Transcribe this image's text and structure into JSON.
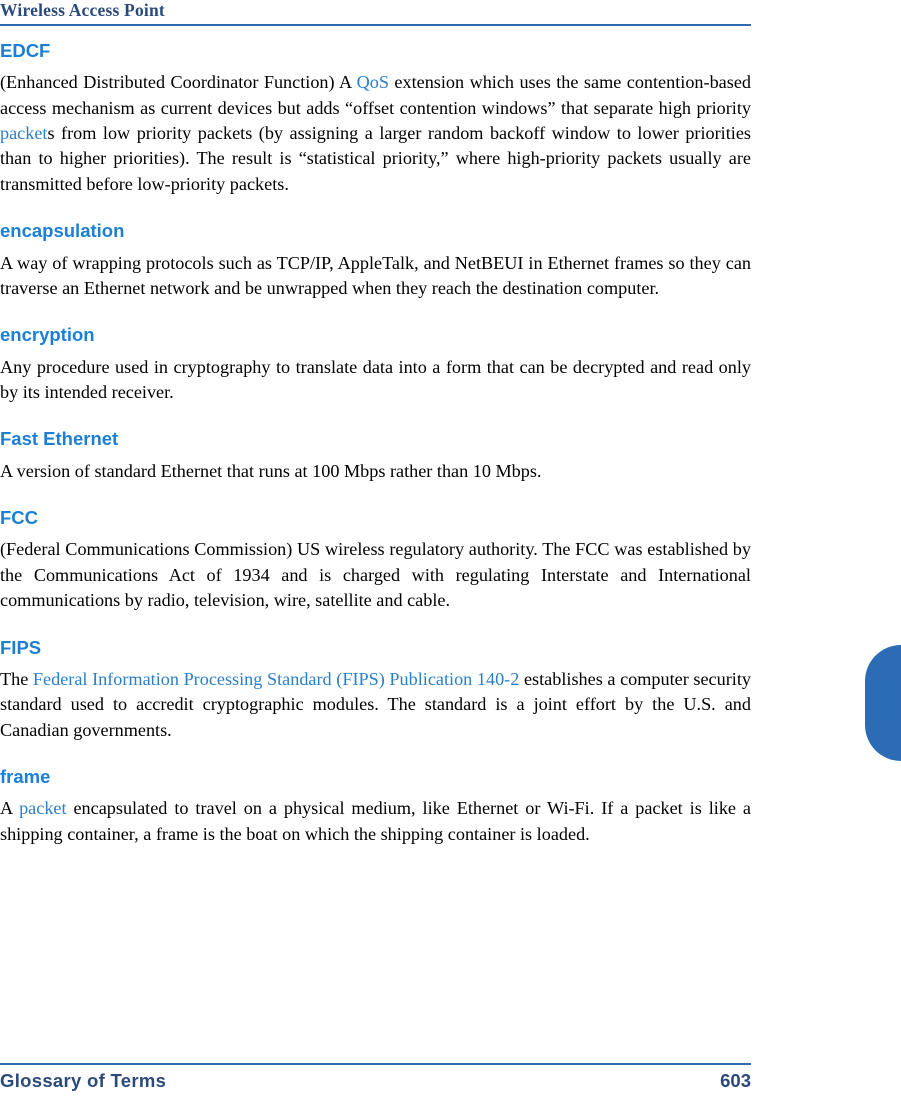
{
  "header": {
    "title": "Wireless Access Point"
  },
  "footer": {
    "section": "Glossary of Terms",
    "page_number": "603"
  },
  "entries": [
    {
      "term": "EDCF",
      "parts": [
        {
          "text": "(Enhanced Distributed Coordinator Function) A ",
          "link": false
        },
        {
          "text": "QoS",
          "link": true
        },
        {
          "text": " extension which uses the same contention-based access mechanism as current devices but adds “offset contention windows” that separate high priority ",
          "link": false
        },
        {
          "text": "packet",
          "link": true
        },
        {
          "text": "s from low priority packets (by assigning a larger random backoff window to lower priorities than to higher priorities). The result is “statistical priority,” where high-priority packets usually are transmitted before low-priority packets.",
          "link": false
        }
      ]
    },
    {
      "term": "encapsulation",
      "parts": [
        {
          "text": "A way of wrapping protocols such as TCP/IP, AppleTalk, and NetBEUI in Ethernet frames so they can traverse an Ethernet network and be unwrapped when they reach the destination computer.",
          "link": false
        }
      ]
    },
    {
      "term": "encryption",
      "parts": [
        {
          "text": "Any procedure used in cryptography to translate data into a form that can be decrypted and read only by its intended receiver.",
          "link": false
        }
      ]
    },
    {
      "term": "Fast Ethernet",
      "parts": [
        {
          "text": "A version of standard Ethernet that runs at 100 Mbps rather than 10 Mbps.",
          "link": false
        }
      ]
    },
    {
      "term": "FCC",
      "parts": [
        {
          "text": "(Federal Communications Commission) US wireless regulatory authority. The FCC was established by the Communications Act of 1934 and is charged with regulating Interstate and International communications by radio, television, wire, satellite and cable.",
          "link": false
        }
      ]
    },
    {
      "term": "FIPS",
      "parts": [
        {
          "text": "The ",
          "link": false
        },
        {
          "text": "Federal Information Processing Standard (FIPS) Publication 140-2",
          "link": true
        },
        {
          "text": " establishes a computer security standard used to accredit cryptographic modules. The standard is a joint effort by the U.S. and Canadian governments.",
          "link": false
        }
      ]
    },
    {
      "term": "frame",
      "parts": [
        {
          "text": "A ",
          "link": false
        },
        {
          "text": "packet",
          "link": true
        },
        {
          "text": " encapsulated to travel on a physical medium, like Ethernet or Wi-Fi. If a packet is like a shipping container, a frame is the boat on which the shipping container is loaded.",
          "link": false
        }
      ]
    }
  ],
  "colors": {
    "heading_blue": "#1c7fd6",
    "rule_blue": "#2b6cb5",
    "header_text": "#2b4a7a",
    "link_blue": "#2a7fc9",
    "tab_blue": "#2b6cb5"
  }
}
